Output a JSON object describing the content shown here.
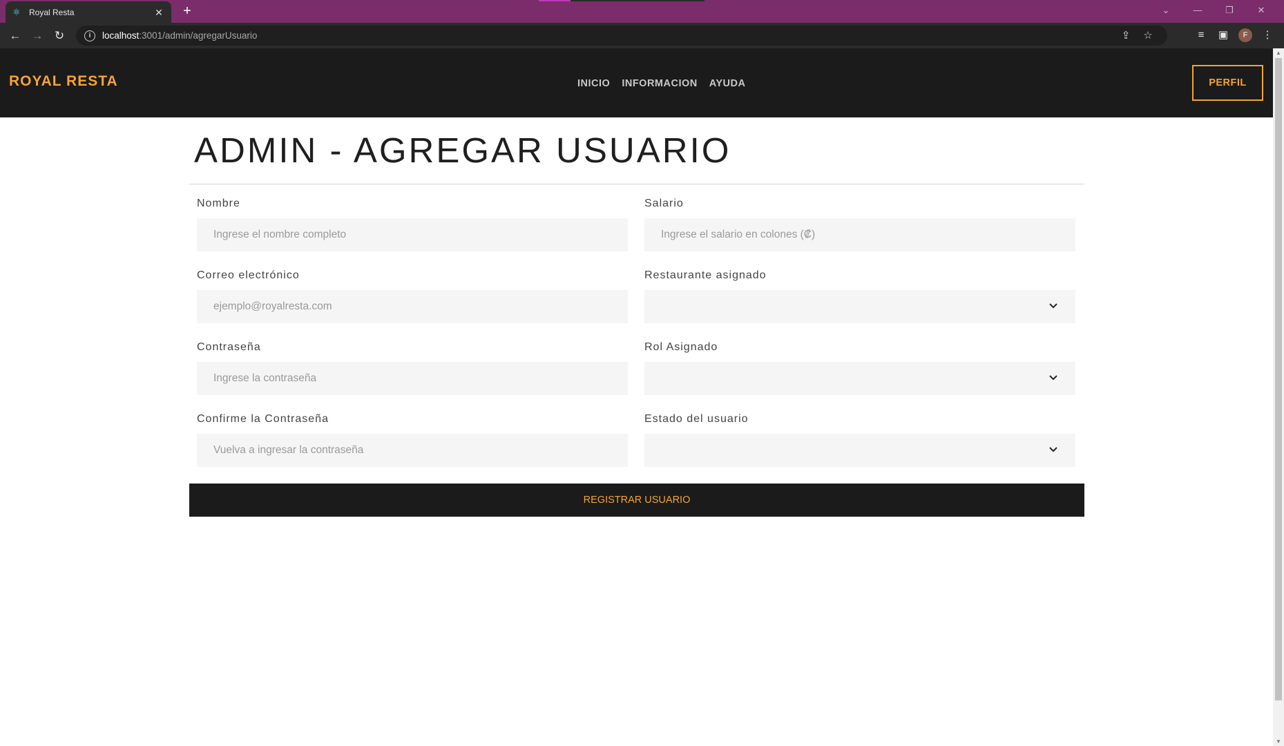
{
  "browser": {
    "tab_title": "Royal Resta",
    "url_host": "localhost",
    "url_path": ":3001/admin/agregarUsuario",
    "profile_initial": "F"
  },
  "nav": {
    "brand": "ROYAL RESTA",
    "links": [
      "INICIO",
      "INFORMACION",
      "AYUDA"
    ],
    "perfil": "PERFIL"
  },
  "page": {
    "title": "ADMIN - AGREGAR USUARIO"
  },
  "form": {
    "nombre": {
      "label": "Nombre",
      "placeholder": "Ingrese el nombre completo"
    },
    "correo": {
      "label": "Correo electrónico",
      "placeholder": "ejemplo@royalresta.com"
    },
    "contrasena": {
      "label": "Contraseña",
      "placeholder": "Ingrese la contraseña"
    },
    "confirmar": {
      "label": "Confirme la Contraseña",
      "placeholder": "Vuelva a ingresar la contraseña"
    },
    "salario": {
      "label": "Salario",
      "placeholder": "Ingrese el salario en colones (₡)"
    },
    "restaurante": {
      "label": "Restaurante asignado",
      "value": ""
    },
    "rol": {
      "label": "Rol Asignado",
      "value": ""
    },
    "estado": {
      "label": "Estado del usuario",
      "value": ""
    },
    "submit": "REGISTRAR USUARIO"
  },
  "colors": {
    "accent": "#f3a533",
    "nav_bg": "#1b1b1b",
    "tabbar_bg": "#7a2d6a"
  }
}
